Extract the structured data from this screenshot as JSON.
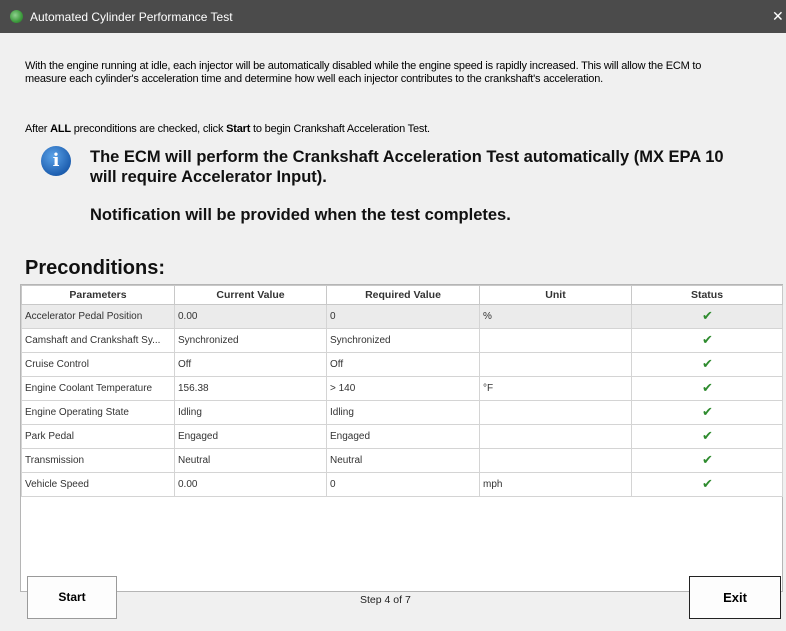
{
  "window": {
    "title": "Automated Cylinder Performance Test",
    "close_label": "✕"
  },
  "intro": {
    "paragraph": "With the engine running at idle, each injector will be automatically disabled while the engine speed is rapidly increased. This will allow the ECM to measure each cylinder's acceleration time and determine how well each injector contributes to the crankshaft's acceleration.",
    "after_prefix": "After ",
    "after_all": "ALL",
    "after_middle": " preconditions are checked, click ",
    "after_start": "Start",
    "after_suffix": " to begin Crankshaft Acceleration Test."
  },
  "info": {
    "icon_glyph": "i",
    "notice": "The ECM will perform the Crankshaft Acceleration Test automatically (MX EPA 10 will require Accelerator Input).",
    "notification": "Notification will be provided when the test completes."
  },
  "preconditions": {
    "title": "Preconditions:",
    "columns": [
      "Parameters",
      "Current Value",
      "Required Value",
      "Unit",
      "Status"
    ],
    "rows": [
      {
        "parameter": "Accelerator Pedal Position",
        "current": "0.00",
        "required": "0",
        "unit": "%",
        "status": "✔"
      },
      {
        "parameter": "Camshaft and Crankshaft Sy...",
        "current": "Synchronized",
        "required": "Synchronized",
        "unit": "",
        "status": "✔"
      },
      {
        "parameter": "Cruise Control",
        "current": "Off",
        "required": "Off",
        "unit": "",
        "status": "✔"
      },
      {
        "parameter": "Engine Coolant Temperature",
        "current": "156.38",
        "required": "> 140",
        "unit": "°F",
        "status": "✔"
      },
      {
        "parameter": "Engine Operating State",
        "current": "Idling",
        "required": "Idling",
        "unit": "",
        "status": "✔"
      },
      {
        "parameter": "Park Pedal",
        "current": "Engaged",
        "required": "Engaged",
        "unit": "",
        "status": "✔"
      },
      {
        "parameter": "Transmission",
        "current": "Neutral",
        "required": "Neutral",
        "unit": "",
        "status": "✔"
      },
      {
        "parameter": "Vehicle Speed",
        "current": "0.00",
        "required": "0",
        "unit": "mph",
        "status": "✔"
      }
    ]
  },
  "footer": {
    "start_label": "Start",
    "step_text": "Step 4 of 7",
    "exit_label": "Exit"
  },
  "colors": {
    "titlebar": "#4b4b4b",
    "check": "#2e8b2e",
    "info_icon": "#1e5fb0"
  }
}
